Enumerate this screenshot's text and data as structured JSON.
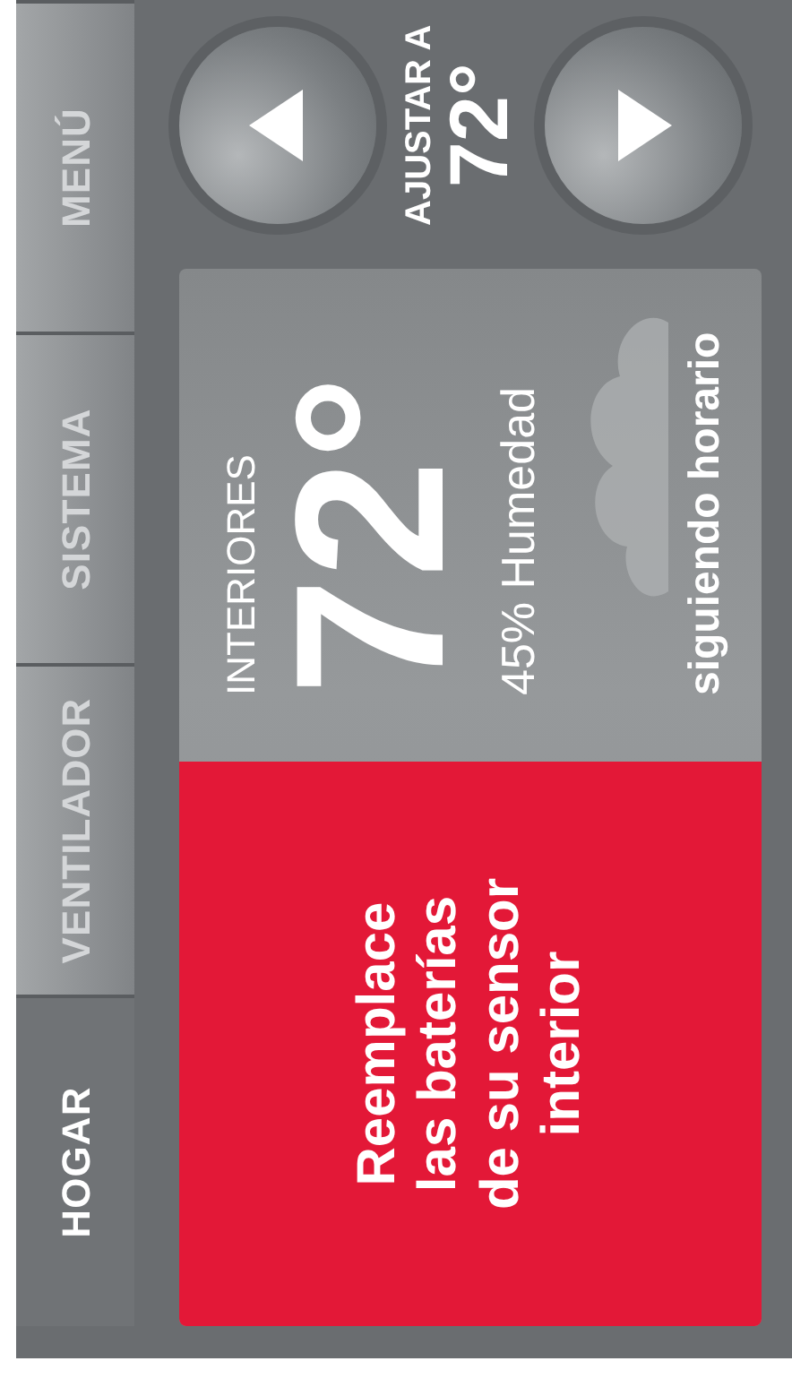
{
  "tabs": [
    {
      "label": "HOGAR",
      "selected": true
    },
    {
      "label": "VENTILADOR",
      "selected": false
    },
    {
      "label": "SISTEMA",
      "selected": false
    },
    {
      "label": "MENÚ",
      "selected": false
    }
  ],
  "indoor": {
    "label": "INTERIORES",
    "temperature": "72°",
    "humidity": "45% Humedad",
    "status": "siguiendo horario"
  },
  "alert": {
    "message": "Reemplace\nlas baterías\nde su sensor\ninterior"
  },
  "setpoint": {
    "label": "AJUSTAR A",
    "temperature": "72°"
  }
}
